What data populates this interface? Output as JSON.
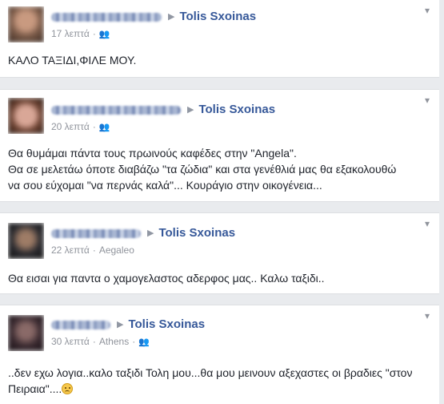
{
  "posts": [
    {
      "target": "Tolis Sxoinas",
      "time": "17 λεπτά",
      "location": "",
      "text_lines": [
        "ΚΑΛΟ ΤΑΞΙΔΙ,ΦΙΛΕ ΜΟΥ."
      ]
    },
    {
      "target": "Tolis Sxoinas",
      "time": "20 λεπτά",
      "location": "",
      "text_lines": [
        "Θα θυμάμαι πάντα τους πρωινούς καφέδες στην \"Angela\".",
        "Θα σε μελετάω όποτε διαβάζω \"τα ζώδια\" και στα γενέθλιά μας θα εξακολουθώ",
        "να σου εύχομαι \"να περνάς καλά\"... Κουράγιο στην οικογένεια..."
      ]
    },
    {
      "target": "Tolis Sxoinas",
      "time": "22 λεπτά",
      "location": "Aegaleo",
      "text_lines": [
        "Θα εισαι για παντα ο χαμογελαστος αδερφος μας.. Καλω ταξιδι.."
      ]
    },
    {
      "target": "Tolis Sxoinas",
      "time": "30 λεπτά",
      "location": "Athens",
      "text_lines": [
        "..δεν εχω λογια..καλο ταξιδι Τολη μου...θα μου μεινουν αξεχαστες οι βραδιες \"στον",
        "Πειραια\"...."
      ]
    }
  ],
  "icons": {
    "arrow": "▶",
    "audience": "friends-icon",
    "menu": "chevron-down-icon"
  },
  "colors": {
    "link": "#365899",
    "meta": "#90949c",
    "background": "#e9ebee"
  }
}
